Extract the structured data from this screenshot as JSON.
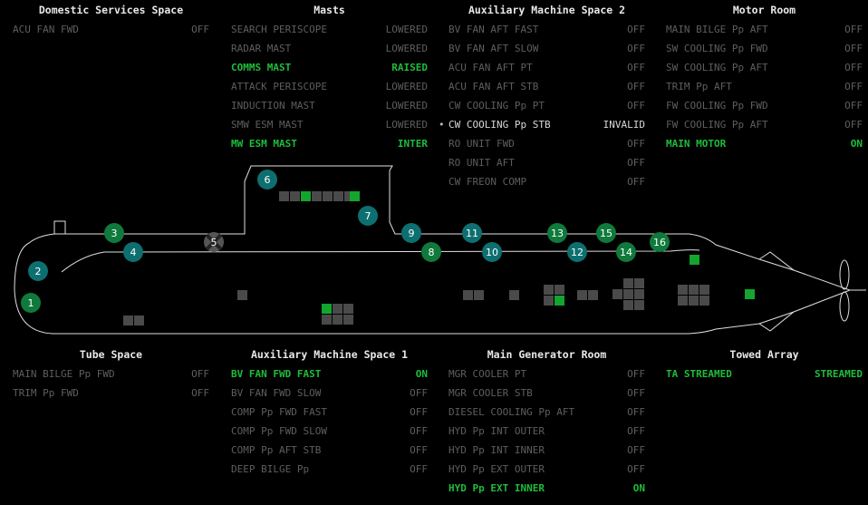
{
  "top_panels": [
    {
      "title": "Domestic Services Space",
      "rows": [
        {
          "label": "ACU FAN FWD",
          "status": "OFF",
          "style": "normal"
        }
      ]
    },
    {
      "title": "Masts",
      "rows": [
        {
          "label": "SEARCH PERISCOPE",
          "status": "LOWERED",
          "style": "normal"
        },
        {
          "label": "RADAR MAST",
          "status": "LOWERED",
          "style": "normal"
        },
        {
          "label": "COMMS MAST",
          "status": "RAISED",
          "style": "active"
        },
        {
          "label": "ATTACK PERISCOPE",
          "status": "LOWERED",
          "style": "normal"
        },
        {
          "label": "INDUCTION MAST",
          "status": "LOWERED",
          "style": "normal"
        },
        {
          "label": "SMW ESM MAST",
          "status": "LOWERED",
          "style": "normal"
        },
        {
          "label": "MW ESM MAST",
          "status": "INTER",
          "style": "active"
        }
      ]
    },
    {
      "title": "Auxiliary Machine Space 2",
      "rows": [
        {
          "label": "BV FAN AFT FAST",
          "status": "OFF",
          "style": "normal"
        },
        {
          "label": "BV FAN AFT SLOW",
          "status": "OFF",
          "style": "normal"
        },
        {
          "label": "ACU FAN AFT PT",
          "status": "OFF",
          "style": "normal"
        },
        {
          "label": "ACU FAN AFT STB",
          "status": "OFF",
          "style": "normal"
        },
        {
          "label": "CW COOLING Pp PT",
          "status": "OFF",
          "style": "normal"
        },
        {
          "label": "CW COOLING Pp STB",
          "status": "INVALID",
          "style": "white"
        },
        {
          "label": "RO UNIT FWD",
          "status": "OFF",
          "style": "normal"
        },
        {
          "label": "RO UNIT AFT",
          "status": "OFF",
          "style": "normal"
        },
        {
          "label": "CW FREON COMP",
          "status": "OFF",
          "style": "normal"
        }
      ]
    },
    {
      "title": "Motor Room",
      "rows": [
        {
          "label": "MAIN BILGE Pp AFT",
          "status": "OFF",
          "style": "normal"
        },
        {
          "label": "SW COOLING Pp FWD",
          "status": "OFF",
          "style": "normal"
        },
        {
          "label": "SW COOLING Pp AFT",
          "status": "OFF",
          "style": "normal"
        },
        {
          "label": "TRIM Pp AFT",
          "status": "OFF",
          "style": "normal"
        },
        {
          "label": "FW COOLING Pp FWD",
          "status": "OFF",
          "style": "normal"
        },
        {
          "label": "FW COOLING Pp AFT",
          "status": "OFF",
          "style": "normal"
        },
        {
          "label": "MAIN MOTOR",
          "status": "ON",
          "style": "active"
        }
      ]
    }
  ],
  "bottom_panels": [
    {
      "title": "Tube Space",
      "rows": [
        {
          "label": "MAIN BILGE Pp FWD",
          "status": "OFF",
          "style": "normal"
        },
        {
          "label": "TRIM Pp FWD",
          "status": "OFF",
          "style": "normal"
        }
      ]
    },
    {
      "title": "Auxiliary Machine Space 1",
      "rows": [
        {
          "label": "BV FAN FWD FAST",
          "status": "ON",
          "style": "active"
        },
        {
          "label": "BV FAN FWD SLOW",
          "status": "OFF",
          "style": "normal"
        },
        {
          "label": "COMP Pp FWD FAST",
          "status": "OFF",
          "style": "normal"
        },
        {
          "label": "COMP Pp FWD SLOW",
          "status": "OFF",
          "style": "normal"
        },
        {
          "label": "COMP Pp AFT STB",
          "status": "OFF",
          "style": "normal"
        },
        {
          "label": "DEEP BILGE Pp",
          "status": "OFF",
          "style": "normal"
        }
      ]
    },
    {
      "title": "Main Generator Room",
      "rows": [
        {
          "label": "MGR COOLER PT",
          "status": "OFF",
          "style": "normal"
        },
        {
          "label": "MGR COOLER STB",
          "status": "OFF",
          "style": "normal"
        },
        {
          "label": "DIESEL COOLING Pp AFT",
          "status": "OFF",
          "style": "normal"
        },
        {
          "label": "HYD Pp INT OUTER",
          "status": "OFF",
          "style": "normal"
        },
        {
          "label": "HYD Pp INT INNER",
          "status": "OFF",
          "style": "normal"
        },
        {
          "label": "HYD Pp EXT OUTER",
          "status": "OFF",
          "style": "normal"
        },
        {
          "label": "HYD Pp EXT INNER",
          "status": "ON",
          "style": "active"
        }
      ]
    },
    {
      "title": "Towed Array",
      "rows": [
        {
          "label": "TA STREAMED",
          "status": "STREAMED",
          "style": "active"
        }
      ]
    }
  ],
  "markers": [
    {
      "n": "1",
      "color": "#0f7a3c"
    },
    {
      "n": "2",
      "color": "#0e6f70"
    },
    {
      "n": "3",
      "color": "#0f7a3c"
    },
    {
      "n": "4",
      "color": "#0e6f70"
    },
    {
      "n": "5",
      "color": "#555555"
    },
    {
      "n": "6",
      "color": "#0e6f70"
    },
    {
      "n": "7",
      "color": "#0e6f70"
    },
    {
      "n": "8",
      "color": "#0f7a3c"
    },
    {
      "n": "9",
      "color": "#0e6f70"
    },
    {
      "n": "10",
      "color": "#0e6f70"
    },
    {
      "n": "11",
      "color": "#0e6f70"
    },
    {
      "n": "12",
      "color": "#0e6f70"
    },
    {
      "n": "13",
      "color": "#0f7a3c"
    },
    {
      "n": "14",
      "color": "#0f7a3c"
    },
    {
      "n": "15",
      "color": "#0f7a3c"
    },
    {
      "n": "16",
      "color": "#0f7a3c"
    }
  ],
  "colors": {
    "active": "#1ebd3c",
    "inactive": "#5e5e5e",
    "off_block": "#4a4a4a",
    "on_block": "#13a52d",
    "outline": "#e0e0e0"
  }
}
